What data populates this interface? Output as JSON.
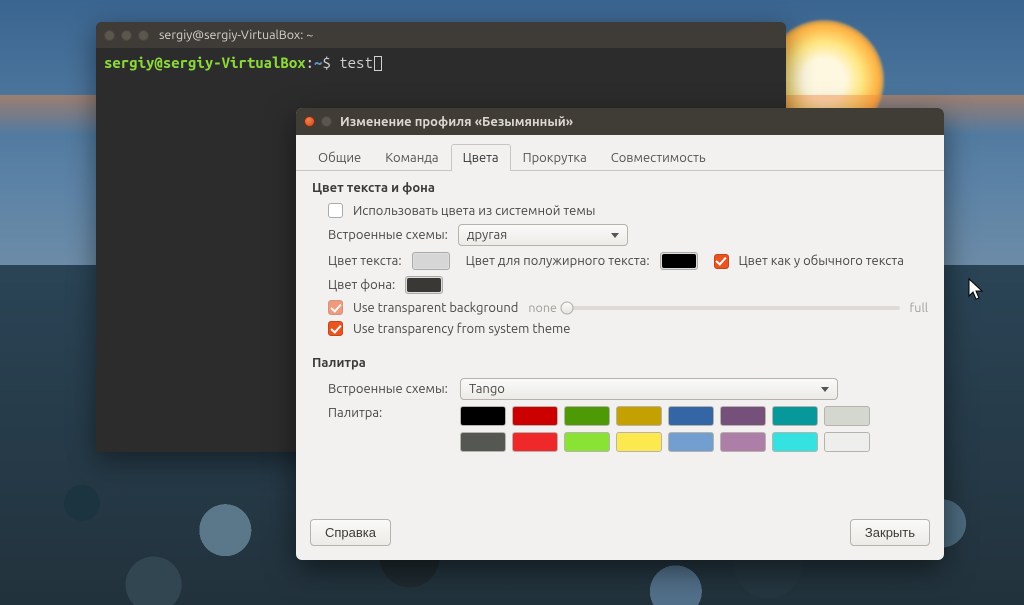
{
  "terminal": {
    "title": "sergiy@sergiy-VirtualBox: ~",
    "prompt_user": "sergiy",
    "prompt_at": "@",
    "prompt_host": "sergiy-VirtualBox",
    "prompt_colon": ":",
    "prompt_cwd": "~",
    "prompt_symbol": "$",
    "command": "test"
  },
  "dialog": {
    "title": "Изменение профиля «Безымянный»",
    "tabs": {
      "general": "Общие",
      "command": "Команда",
      "colors": "Цвета",
      "scrolling": "Прокрутка",
      "compat": "Совместимость"
    },
    "text_bg_section": "Цвет текста и фона",
    "use_system_colors_label": "Использовать цвета из системной темы",
    "builtin_schemes_label": "Встроенные схемы:",
    "builtin_schemes_value": "другая",
    "text_color_label": "Цвет текста:",
    "text_color_value": "#d6d6d6",
    "bold_color_label": "Цвет для полужирного текста:",
    "bold_color_value": "#000000",
    "bold_same_label": "Цвет как у обычного текста",
    "bg_color_label": "Цвет фона:",
    "bg_color_value": "#3a3835",
    "use_trans_bg_label": "Use transparent background",
    "trans_none": "none",
    "trans_full": "full",
    "use_trans_system_label": "Use transparency from system theme",
    "palette_section": "Палитра",
    "palette_schemes_label": "Встроенные схемы:",
    "palette_schemes_value": "Tango",
    "palette_label": "Палитра:",
    "palette_colors_row1": [
      "#000000",
      "#cc0000",
      "#4e9a06",
      "#c4a000",
      "#3465a4",
      "#75507b",
      "#06989a",
      "#d3d7cf"
    ],
    "palette_colors_row2": [
      "#555753",
      "#ef2929",
      "#8ae234",
      "#fce94f",
      "#729fcf",
      "#ad7fa8",
      "#34e2e2",
      "#eeeeec"
    ],
    "help_button": "Справка",
    "close_button": "Закрыть"
  }
}
